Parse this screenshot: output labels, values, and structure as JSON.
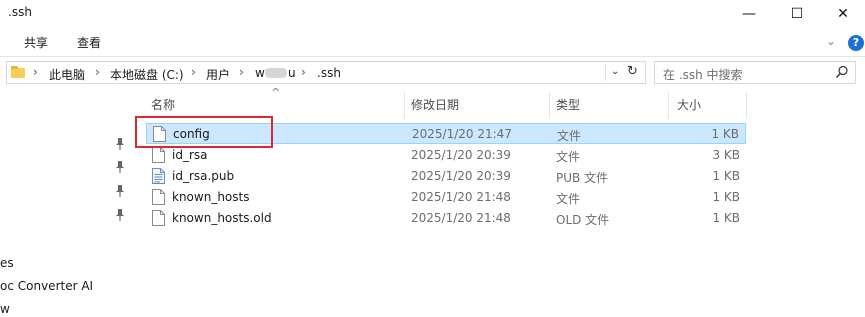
{
  "window": {
    "title": ".ssh",
    "minimize_glyph": "—",
    "maximize_glyph": "☐",
    "close_glyph": "✕"
  },
  "ribbon": {
    "tabs": [
      "共享",
      "查看"
    ],
    "expand_glyph": "⌄",
    "help_glyph": "?"
  },
  "address": {
    "crumbs": [
      "此电脑",
      "本地磁盘 (C:)",
      "用户",
      "w",
      "u",
      ".ssh"
    ],
    "separator": "›",
    "dropdown_glyph": "⌄",
    "refresh_glyph": "↻"
  },
  "search": {
    "placeholder": "在 .ssh 中搜索",
    "icon": "search-icon"
  },
  "columns": {
    "sort_glyph": "^",
    "name": "名称",
    "date": "修改日期",
    "type": "类型",
    "size": "大小"
  },
  "files": [
    {
      "name": "config",
      "date": "2025/1/20 21:47",
      "type": "文件",
      "size": "1 KB",
      "icon": "file-icon",
      "selected": true
    },
    {
      "name": "id_rsa",
      "date": "2025/1/20 20:39",
      "type": "文件",
      "size": "3 KB",
      "icon": "file-icon",
      "selected": false
    },
    {
      "name": "id_rsa.pub",
      "date": "2025/1/20 20:39",
      "type": "PUB 文件",
      "size": "1 KB",
      "icon": "pub-file-icon",
      "selected": false
    },
    {
      "name": "known_hosts",
      "date": "2025/1/20 21:48",
      "type": "文件",
      "size": "1 KB",
      "icon": "file-icon",
      "selected": false
    },
    {
      "name": "known_hosts.old",
      "date": "2025/1/20 21:48",
      "type": "OLD 文件",
      "size": "1 KB",
      "icon": "file-icon",
      "selected": false
    }
  ],
  "nav_pane": {
    "pin_glyph": "📌",
    "items": [
      "es",
      "oc Converter AI",
      "w"
    ]
  },
  "colors": {
    "selection_bg": "#cce8ff",
    "selection_border": "#99d1ff",
    "highlight_box": "#e0282c"
  }
}
